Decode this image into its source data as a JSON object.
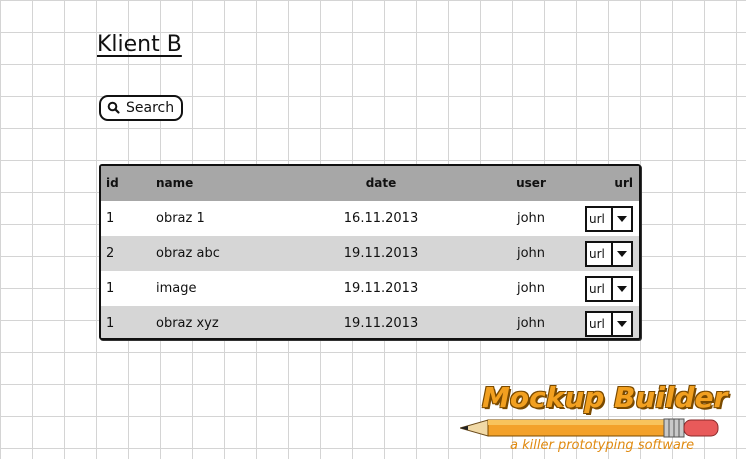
{
  "page": {
    "title": "Klient B"
  },
  "search": {
    "label": "Search"
  },
  "table": {
    "columns": [
      "id",
      "name",
      "date",
      "user",
      "url"
    ],
    "rows": [
      {
        "id": "1",
        "name": "obraz 1",
        "date": "16.11.2013",
        "user": "john",
        "url": "url"
      },
      {
        "id": "2",
        "name": "obraz abc",
        "date": "19.11.2013",
        "user": "john",
        "url": "url"
      },
      {
        "id": "1",
        "name": "image",
        "date": "19.11.2013",
        "user": "john",
        "url": "url"
      },
      {
        "id": "1",
        "name": "obraz xyz",
        "date": "19.11.2013",
        "user": "john",
        "url": "url"
      }
    ]
  },
  "branding": {
    "title": "Mockup Builder",
    "tagline": "a killer prototyping software"
  }
}
